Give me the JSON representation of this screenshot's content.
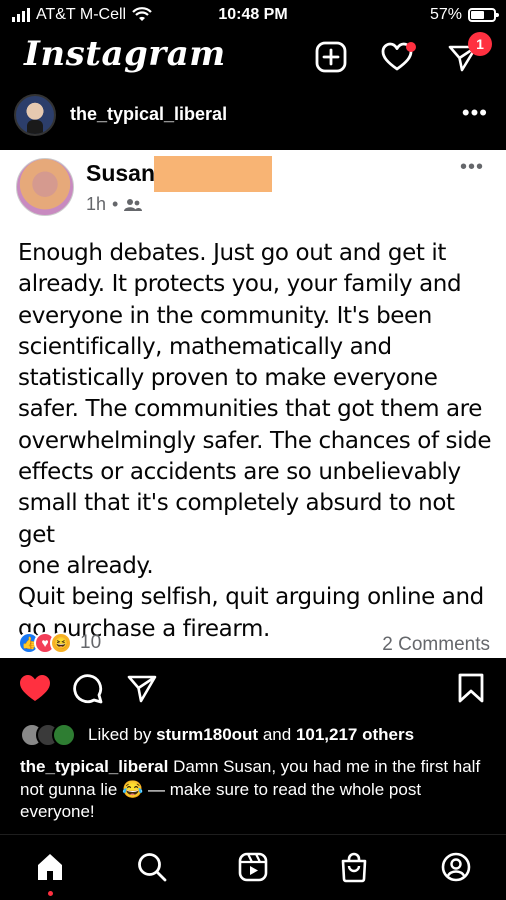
{
  "status_bar": {
    "carrier": "AT&T M-Cell",
    "time": "10:48 PM",
    "battery": "57%",
    "battery_level": 0.57
  },
  "header": {
    "app_name": "Instagram",
    "icons": [
      "new-post-icon",
      "heart-icon",
      "direct-message-icon"
    ],
    "dm_badge": "1",
    "accent": "#ff3040"
  },
  "post": {
    "username": "the_typical_liberal",
    "embedded_facebook_post": {
      "author_first_name": "Susan",
      "time": "1h",
      "audience_icon": "friends-icon",
      "text_lines": [
        "Enough debates. Just go out and get it",
        "already. It protects you, your family and",
        "everyone in the community. It's been",
        "scientifically, mathematically and",
        "statistically proven to make everyone",
        "safer. The communities that got them are",
        "overwhelmingly safer. The chances of side",
        "effects or accidents are so unbelievably",
        "small that it's completely absurd to not get",
        "one already.",
        "Quit being selfish, quit arguing online and",
        "go purchase a firearm."
      ],
      "reaction_icons": [
        "like-icon",
        "love-icon",
        "haha-icon"
      ],
      "reaction_count": "10",
      "comments": "2 Comments"
    },
    "actions": [
      "like-icon",
      "comment-icon",
      "share-icon",
      "save-icon"
    ],
    "liked_by": {
      "prefix": "Liked by",
      "user": "sturm180out",
      "and": "and",
      "others": "101,217 others"
    },
    "caption": {
      "username": "the_typical_liberal",
      "text": "Damn Susan, you had me in the first half not gunna lie 😂 — make sure to read the whole post everyone!"
    }
  },
  "tab_bar": {
    "items": [
      "home-icon",
      "search-icon",
      "reels-icon",
      "shop-icon",
      "profile-icon"
    ]
  }
}
